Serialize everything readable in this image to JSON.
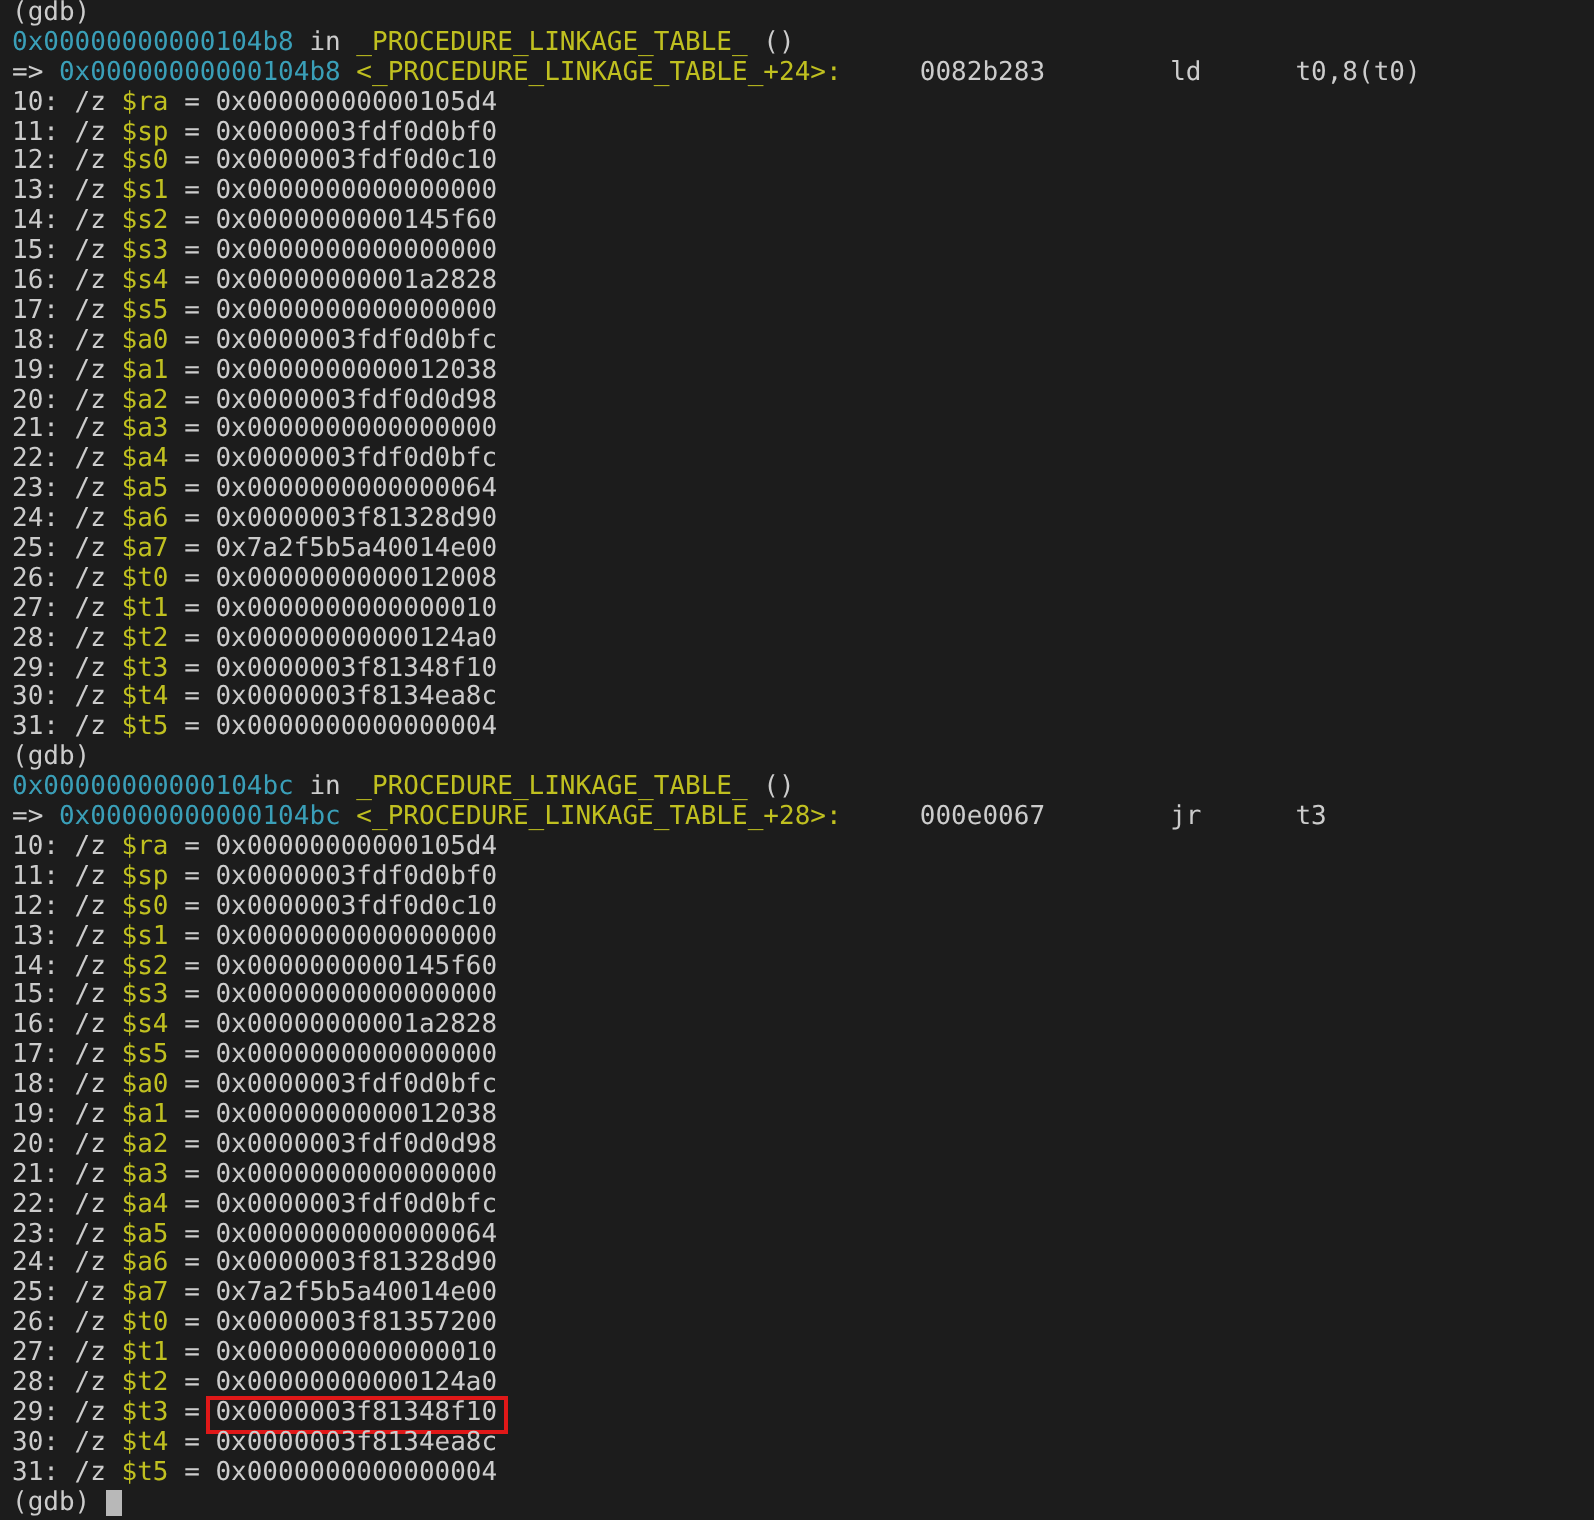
{
  "terminal": {
    "stops": [
      {
        "prompt": "(gdb)",
        "location": {
          "address": "0x00000000000104b8",
          "word": "in",
          "function": "_PROCEDURE_LINKAGE_TABLE_",
          "args": "()"
        },
        "instruction": {
          "arrow": "=>",
          "address": "0x00000000000104b8",
          "symbol": "<_PROCEDURE_LINKAGE_TABLE_+24>:",
          "encoding": "0082b283",
          "mnemonic": "ld",
          "operands": "t0,8(t0)"
        },
        "registers": [
          {
            "index": "10:",
            "format": "/z",
            "name": "$ra",
            "equals": "=",
            "value": "0x00000000000105d4",
            "highlighted": false
          },
          {
            "index": "11:",
            "format": "/z",
            "name": "$sp",
            "equals": "=",
            "value": "0x0000003fdf0d0bf0",
            "highlighted": false
          },
          {
            "index": "12:",
            "format": "/z",
            "name": "$s0",
            "equals": "=",
            "value": "0x0000003fdf0d0c10",
            "highlighted": false
          },
          {
            "index": "13:",
            "format": "/z",
            "name": "$s1",
            "equals": "=",
            "value": "0x0000000000000000",
            "highlighted": false
          },
          {
            "index": "14:",
            "format": "/z",
            "name": "$s2",
            "equals": "=",
            "value": "0x0000000000145f60",
            "highlighted": false
          },
          {
            "index": "15:",
            "format": "/z",
            "name": "$s3",
            "equals": "=",
            "value": "0x0000000000000000",
            "highlighted": false
          },
          {
            "index": "16:",
            "format": "/z",
            "name": "$s4",
            "equals": "=",
            "value": "0x00000000001a2828",
            "highlighted": false
          },
          {
            "index": "17:",
            "format": "/z",
            "name": "$s5",
            "equals": "=",
            "value": "0x0000000000000000",
            "highlighted": false
          },
          {
            "index": "18:",
            "format": "/z",
            "name": "$a0",
            "equals": "=",
            "value": "0x0000003fdf0d0bfc",
            "highlighted": false
          },
          {
            "index": "19:",
            "format": "/z",
            "name": "$a1",
            "equals": "=",
            "value": "0x0000000000012038",
            "highlighted": false
          },
          {
            "index": "20:",
            "format": "/z",
            "name": "$a2",
            "equals": "=",
            "value": "0x0000003fdf0d0d98",
            "highlighted": false
          },
          {
            "index": "21:",
            "format": "/z",
            "name": "$a3",
            "equals": "=",
            "value": "0x0000000000000000",
            "highlighted": false
          },
          {
            "index": "22:",
            "format": "/z",
            "name": "$a4",
            "equals": "=",
            "value": "0x0000003fdf0d0bfc",
            "highlighted": false
          },
          {
            "index": "23:",
            "format": "/z",
            "name": "$a5",
            "equals": "=",
            "value": "0x0000000000000064",
            "highlighted": false
          },
          {
            "index": "24:",
            "format": "/z",
            "name": "$a6",
            "equals": "=",
            "value": "0x0000003f81328d90",
            "highlighted": false
          },
          {
            "index": "25:",
            "format": "/z",
            "name": "$a7",
            "equals": "=",
            "value": "0x7a2f5b5a40014e00",
            "highlighted": false
          },
          {
            "index": "26:",
            "format": "/z",
            "name": "$t0",
            "equals": "=",
            "value": "0x0000000000012008",
            "highlighted": false
          },
          {
            "index": "27:",
            "format": "/z",
            "name": "$t1",
            "equals": "=",
            "value": "0x0000000000000010",
            "highlighted": false
          },
          {
            "index": "28:",
            "format": "/z",
            "name": "$t2",
            "equals": "=",
            "value": "0x00000000000124a0",
            "highlighted": false
          },
          {
            "index": "29:",
            "format": "/z",
            "name": "$t3",
            "equals": "=",
            "value": "0x0000003f81348f10",
            "highlighted": false
          },
          {
            "index": "30:",
            "format": "/z",
            "name": "$t4",
            "equals": "=",
            "value": "0x0000003f8134ea8c",
            "highlighted": false
          },
          {
            "index": "31:",
            "format": "/z",
            "name": "$t5",
            "equals": "=",
            "value": "0x0000000000000004",
            "highlighted": false
          }
        ]
      },
      {
        "prompt": "(gdb)",
        "location": {
          "address": "0x00000000000104bc",
          "word": "in",
          "function": "_PROCEDURE_LINKAGE_TABLE_",
          "args": "()"
        },
        "instruction": {
          "arrow": "=>",
          "address": "0x00000000000104bc",
          "symbol": "<_PROCEDURE_LINKAGE_TABLE_+28>:",
          "encoding": "000e0067",
          "mnemonic": "jr",
          "operands": "t3"
        },
        "registers": [
          {
            "index": "10:",
            "format": "/z",
            "name": "$ra",
            "equals": "=",
            "value": "0x00000000000105d4",
            "highlighted": false
          },
          {
            "index": "11:",
            "format": "/z",
            "name": "$sp",
            "equals": "=",
            "value": "0x0000003fdf0d0bf0",
            "highlighted": false
          },
          {
            "index": "12:",
            "format": "/z",
            "name": "$s0",
            "equals": "=",
            "value": "0x0000003fdf0d0c10",
            "highlighted": false
          },
          {
            "index": "13:",
            "format": "/z",
            "name": "$s1",
            "equals": "=",
            "value": "0x0000000000000000",
            "highlighted": false
          },
          {
            "index": "14:",
            "format": "/z",
            "name": "$s2",
            "equals": "=",
            "value": "0x0000000000145f60",
            "highlighted": false
          },
          {
            "index": "15:",
            "format": "/z",
            "name": "$s3",
            "equals": "=",
            "value": "0x0000000000000000",
            "highlighted": false
          },
          {
            "index": "16:",
            "format": "/z",
            "name": "$s4",
            "equals": "=",
            "value": "0x00000000001a2828",
            "highlighted": false
          },
          {
            "index": "17:",
            "format": "/z",
            "name": "$s5",
            "equals": "=",
            "value": "0x0000000000000000",
            "highlighted": false
          },
          {
            "index": "18:",
            "format": "/z",
            "name": "$a0",
            "equals": "=",
            "value": "0x0000003fdf0d0bfc",
            "highlighted": false
          },
          {
            "index": "19:",
            "format": "/z",
            "name": "$a1",
            "equals": "=",
            "value": "0x0000000000012038",
            "highlighted": false
          },
          {
            "index": "20:",
            "format": "/z",
            "name": "$a2",
            "equals": "=",
            "value": "0x0000003fdf0d0d98",
            "highlighted": false
          },
          {
            "index": "21:",
            "format": "/z",
            "name": "$a3",
            "equals": "=",
            "value": "0x0000000000000000",
            "highlighted": false
          },
          {
            "index": "22:",
            "format": "/z",
            "name": "$a4",
            "equals": "=",
            "value": "0x0000003fdf0d0bfc",
            "highlighted": false
          },
          {
            "index": "23:",
            "format": "/z",
            "name": "$a5",
            "equals": "=",
            "value": "0x0000000000000064",
            "highlighted": false
          },
          {
            "index": "24:",
            "format": "/z",
            "name": "$a6",
            "equals": "=",
            "value": "0x0000003f81328d90",
            "highlighted": false
          },
          {
            "index": "25:",
            "format": "/z",
            "name": "$a7",
            "equals": "=",
            "value": "0x7a2f5b5a40014e00",
            "highlighted": false
          },
          {
            "index": "26:",
            "format": "/z",
            "name": "$t0",
            "equals": "=",
            "value": "0x0000003f81357200",
            "highlighted": false
          },
          {
            "index": "27:",
            "format": "/z",
            "name": "$t1",
            "equals": "=",
            "value": "0x0000000000000010",
            "highlighted": false
          },
          {
            "index": "28:",
            "format": "/z",
            "name": "$t2",
            "equals": "=",
            "value": "0x00000000000124a0",
            "highlighted": false
          },
          {
            "index": "29:",
            "format": "/z",
            "name": "$t3",
            "equals": "=",
            "value": "0x0000003f81348f10",
            "highlighted": true
          },
          {
            "index": "30:",
            "format": "/z",
            "name": "$t4",
            "equals": "=",
            "value": "0x0000003f8134ea8c",
            "highlighted": false
          },
          {
            "index": "31:",
            "format": "/z",
            "name": "$t5",
            "equals": "=",
            "value": "0x0000000000000004",
            "highlighted": false
          }
        ]
      }
    ],
    "final_prompt": {
      "prompt": "(gdb)",
      "cursor": true
    }
  }
}
